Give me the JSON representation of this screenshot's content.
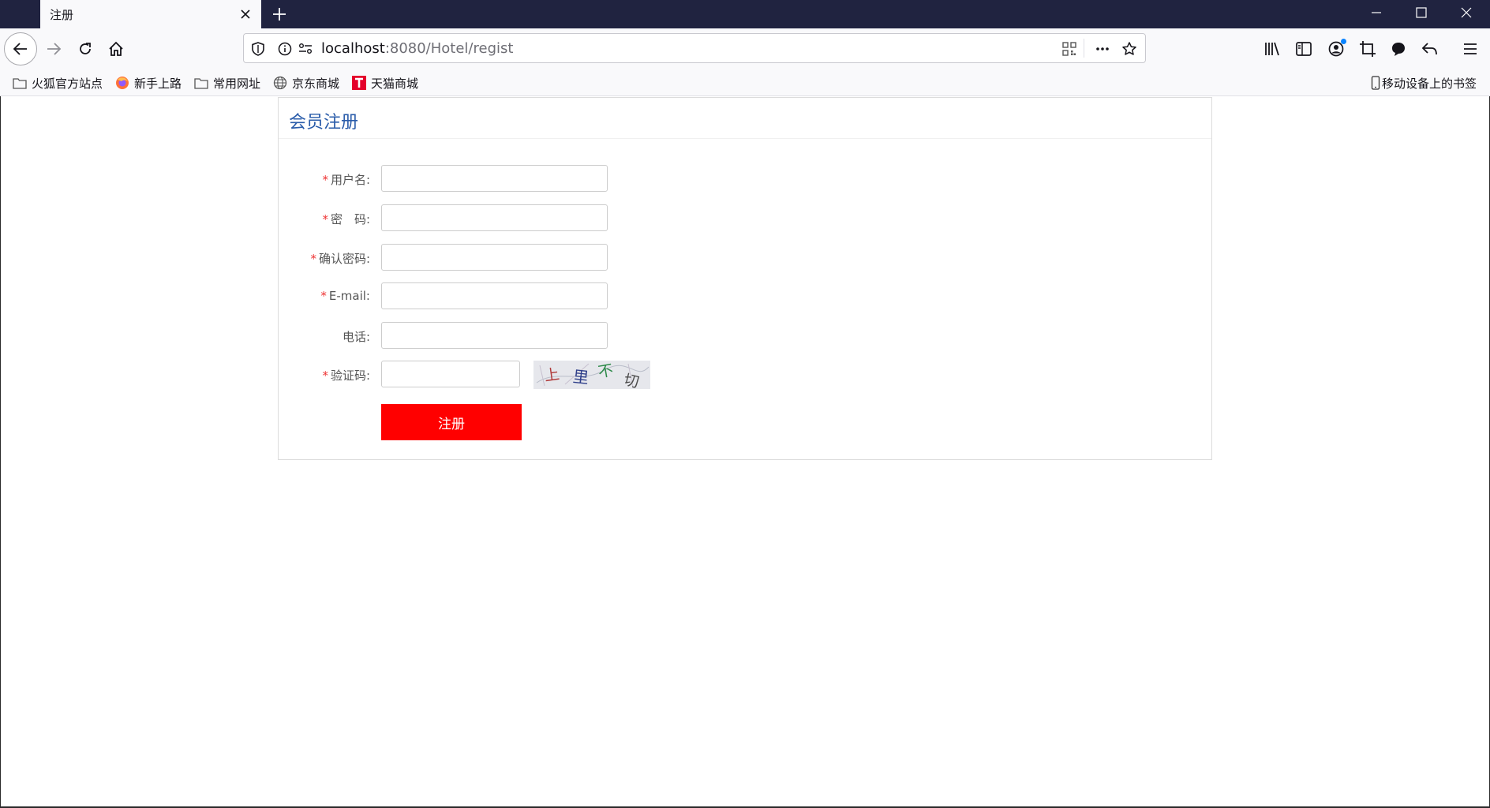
{
  "browser": {
    "tab_title": "注册",
    "url_host": "localhost",
    "url_rest": ":8080/Hotel/regist",
    "accent_color": "#0a84ff",
    "titlebar_color": "#202340"
  },
  "bookmarks": [
    {
      "label": "火狐官方站点",
      "icon": "folder-icon"
    },
    {
      "label": "新手上路",
      "icon": "firefox-icon"
    },
    {
      "label": "常用网址",
      "icon": "folder-icon"
    },
    {
      "label": "京东商城",
      "icon": "globe-icon"
    },
    {
      "label": "天猫商城",
      "icon": "tmall-icon"
    }
  ],
  "mobile_bookmarks": "移动设备上的书签",
  "page": {
    "title": "会员注册",
    "title_color": "#2a5caa",
    "required_mark": "*",
    "fields": [
      {
        "label": "用户名:",
        "required": true,
        "value": ""
      },
      {
        "label": "密　码:",
        "required": true,
        "value": ""
      },
      {
        "label": "确认密码:",
        "required": true,
        "value": ""
      },
      {
        "label": "E-mail:",
        "required": true,
        "value": ""
      },
      {
        "label": "电话:",
        "required": false,
        "value": ""
      },
      {
        "label": "验证码:",
        "required": true,
        "value": ""
      }
    ],
    "captcha_text": "上里不切",
    "submit_label": "注册",
    "submit_color": "#ff0000"
  }
}
